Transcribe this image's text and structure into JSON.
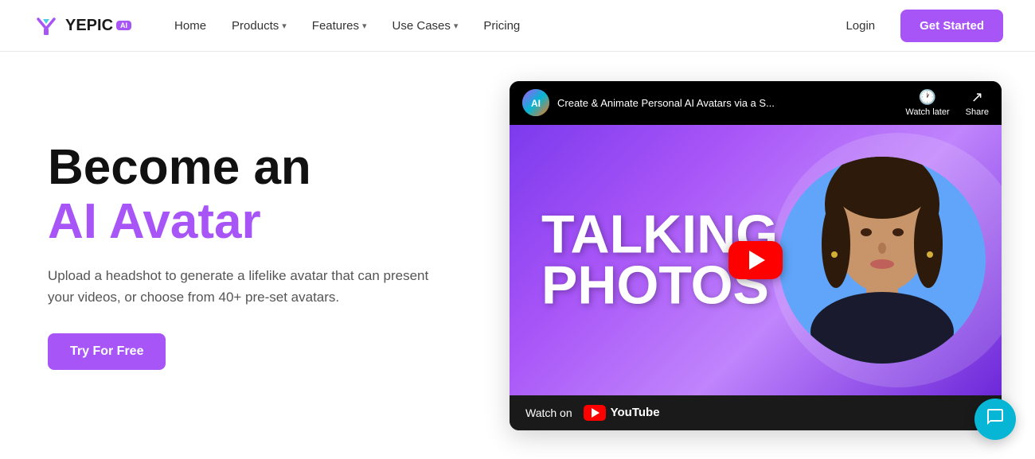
{
  "navbar": {
    "logo": {
      "text": "YEPIC",
      "ai_badge": "AI"
    },
    "nav_items": [
      {
        "label": "Home",
        "has_dropdown": false
      },
      {
        "label": "Products",
        "has_dropdown": true
      },
      {
        "label": "Features",
        "has_dropdown": true
      },
      {
        "label": "Use Cases",
        "has_dropdown": true
      },
      {
        "label": "Pricing",
        "has_dropdown": false
      }
    ],
    "login_label": "Login",
    "get_started_label": "Get Started"
  },
  "hero": {
    "title_line1": "Become an",
    "title_line2": "AI Avatar",
    "description": "Upload a headshot to generate a lifelike avatar that can present your videos, or choose from 40+ pre-set avatars.",
    "cta_label": "Try For Free"
  },
  "video": {
    "channel_avatar_text": "AI",
    "title": "Create & Animate Personal AI Avatars via a S...",
    "watch_later_label": "Watch later",
    "share_label": "Share",
    "thumbnail_line1": "TALKING",
    "thumbnail_line2": "PHOTOS",
    "watch_on_label": "Watch on",
    "youtube_label": "YouTube"
  },
  "chat": {
    "icon": "💬"
  }
}
